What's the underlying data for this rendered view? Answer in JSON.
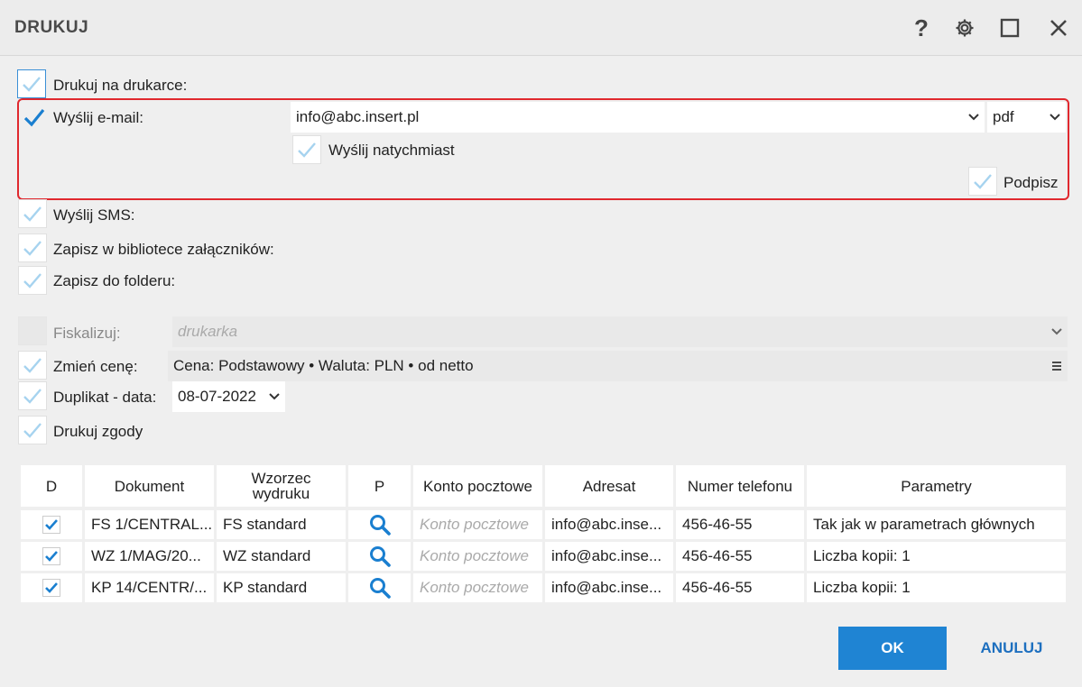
{
  "window": {
    "title": "DRUKUJ",
    "help_glyph": "?"
  },
  "options": {
    "print_label": "Drukuj na drukarce:",
    "email_label": "Wyślij e-mail:",
    "email_value": "info@abc.insert.pl",
    "format_value": "pdf",
    "send_now_label": "Wyślij natychmiast",
    "signature_label": "Podpisz",
    "sms_label": "Wyślij SMS:",
    "library_label": "Zapisz w bibliotece załączników:",
    "folder_label": "Zapisz do folderu:",
    "fiscal_label": "Fiskalizuj:",
    "fiscal_placeholder": "drukarka",
    "price_label": "Zmień cenę:",
    "price_value": "Cena: Podstawowy • Waluta: PLN • od netto",
    "duplicate_label": "Duplikat - data:",
    "duplicate_date": "08-07-2022",
    "consents_label": "Drukuj zgody"
  },
  "table": {
    "headers": {
      "d": "D",
      "document": "Dokument",
      "template_line1": "Wzorzec",
      "template_line2": "wydruku",
      "p": "P",
      "mailbox": "Konto pocztowe",
      "recipient": "Adresat",
      "phone": "Numer telefonu",
      "params": "Parametry"
    },
    "rows": [
      {
        "document": "FS 1/CENTRAL...",
        "template": "FS standard",
        "mailbox": "Konto pocztowe",
        "recipient": "info@abc.inse...",
        "phone": "456-46-55",
        "params": "Tak jak w parametrach głównych"
      },
      {
        "document": "WZ 1/MAG/20...",
        "template": "WZ standard",
        "mailbox": "Konto pocztowe",
        "recipient": "info@abc.inse...",
        "phone": "456-46-55",
        "params": "Liczba kopii: 1"
      },
      {
        "document": "KP 14/CENTR/...",
        "template": "KP standard",
        "mailbox": "Konto pocztowe",
        "recipient": "info@abc.inse...",
        "phone": "456-46-55",
        "params": "Liczba kopii: 1"
      }
    ]
  },
  "buttons": {
    "ok": "OK",
    "cancel": "ANULUJ"
  },
  "colors": {
    "accent": "#1f84d3",
    "highlight_border": "#e0282e",
    "check_active": "#1a7fd0",
    "check_inactive": "#a6d3ef"
  }
}
